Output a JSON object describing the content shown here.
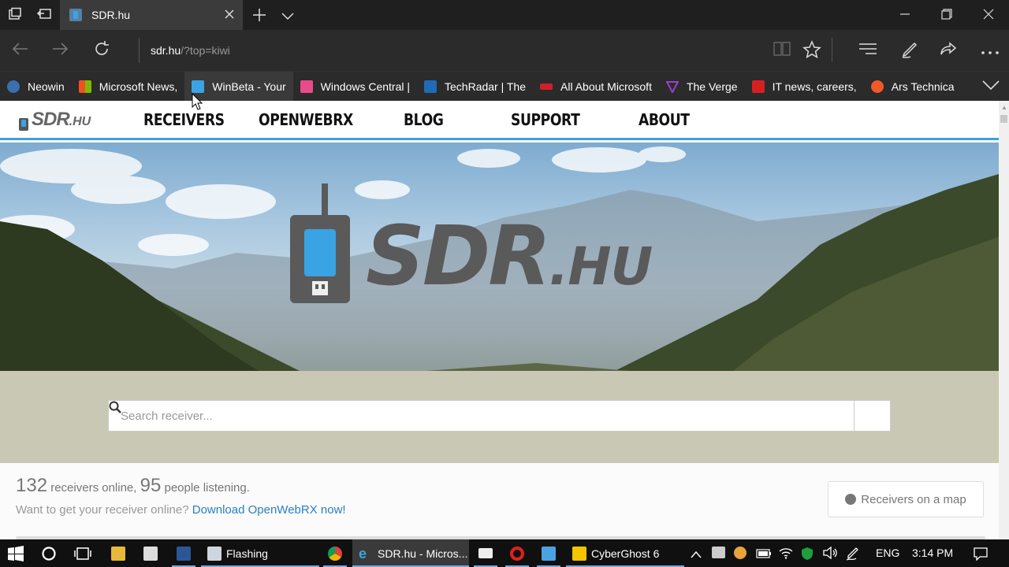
{
  "browser": {
    "tab": {
      "title": "SDR.hu"
    },
    "address": {
      "host": "sdr.hu",
      "path": "/?top=kiwi"
    },
    "favorites": [
      {
        "label": "Neowin",
        "color": "#3a6fb0"
      },
      {
        "label": "Microsoft News,",
        "color": "#f25022"
      },
      {
        "label": "WinBeta - Your",
        "color": "#3aa3e3"
      },
      {
        "label": "Windows Central |",
        "color": "#e84b8a"
      },
      {
        "label": "TechRadar | The",
        "color": "#1e6bb8"
      },
      {
        "label": "All About Microsoft",
        "color": "#d01f2a"
      },
      {
        "label": "The Verge",
        "color": "#9b3fd1"
      },
      {
        "label": "IT news, careers,",
        "color": "#d62020"
      },
      {
        "label": "Ars Technica",
        "color": "#f05a28"
      }
    ]
  },
  "site": {
    "logo": {
      "main": "SDR",
      "suffix": ".HU"
    },
    "nav": [
      "RECEIVERS",
      "OPENWEBRX",
      "BLOG",
      "SUPPORT",
      "ABOUT"
    ],
    "hero_logo": {
      "main": "SDR",
      "suffix": ".HU"
    },
    "search": {
      "placeholder": "Search receiver..."
    },
    "stats": {
      "receivers": "132",
      "receivers_text": "receivers online,",
      "people": "95",
      "people_text": "people listening."
    },
    "cta": {
      "text": "Want to get your receiver online?",
      "link": "Download OpenWebRX now!"
    },
    "map_button": "Receivers on a map"
  },
  "taskbar": {
    "apps": [
      {
        "label": "Flashing"
      },
      {
        "label": "SDR.hu - Micros..."
      },
      {
        "label": "CyberGhost 6"
      }
    ],
    "lang": "ENG",
    "time": "3:14 PM"
  },
  "colors": {
    "accent": "#3aa3d6",
    "link": "#2a7fc1"
  }
}
